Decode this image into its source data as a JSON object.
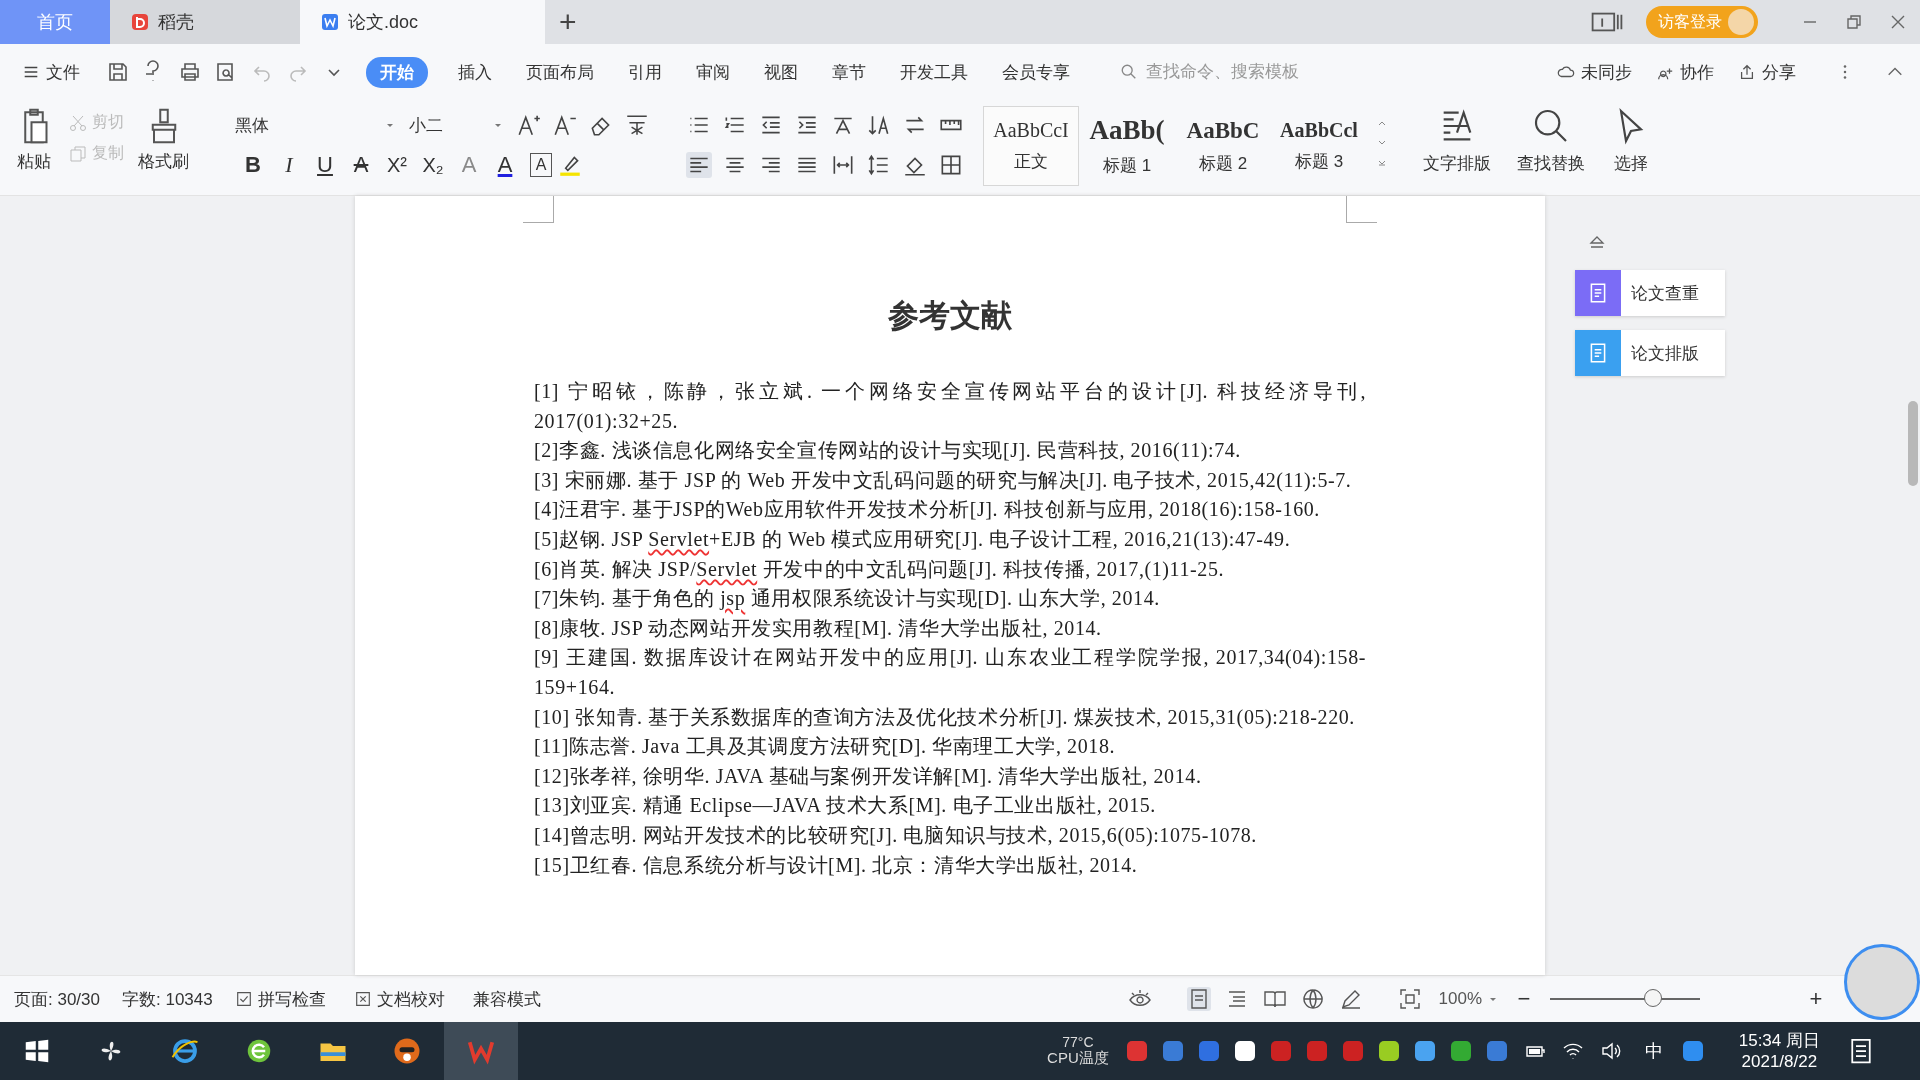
{
  "tabs": [
    {
      "label": "首页",
      "selected": false,
      "kind": "home"
    },
    {
      "label": "稻壳",
      "selected": false,
      "kind": "docer"
    },
    {
      "label": "论文.doc",
      "selected": true,
      "kind": "doc"
    }
  ],
  "new_tab": "+",
  "account": {
    "label": "访客登录"
  },
  "menu": {
    "file": "文件",
    "items": [
      {
        "label": "开始",
        "selected": true
      },
      {
        "label": "插入",
        "selected": false
      },
      {
        "label": "页面布局",
        "selected": false
      },
      {
        "label": "引用",
        "selected": false
      },
      {
        "label": "审阅",
        "selected": false
      },
      {
        "label": "视图",
        "selected": false
      },
      {
        "label": "章节",
        "selected": false
      },
      {
        "label": "开发工具",
        "selected": false
      },
      {
        "label": "会员专享",
        "selected": false
      }
    ],
    "search_placeholder": "查找命令、搜索模板",
    "actions": [
      "未同步",
      "协作",
      "分享"
    ]
  },
  "ribbon": {
    "paste": "粘贴",
    "cut": {
      "label": "剪切",
      "disabled": true
    },
    "copy": {
      "label": "复制",
      "disabled": true
    },
    "format_painter": "格式刷",
    "font": "黑体",
    "size": "小二",
    "font_buttons": [
      {
        "glyph": "B",
        "kind": "bold"
      },
      {
        "glyph": "I",
        "kind": "italic"
      },
      {
        "glyph": "U",
        "kind": "underline"
      },
      {
        "glyph": "A",
        "kind": "strike"
      },
      {
        "glyph": "X²",
        "kind": "super"
      },
      {
        "glyph": "X₂",
        "kind": "sub"
      },
      {
        "glyph": "A",
        "kind": "effect"
      },
      {
        "glyph": "A",
        "kind": "color"
      },
      {
        "glyph": "A",
        "kind": "border"
      }
    ],
    "styles": [
      {
        "preview": "AaBbCcI",
        "label": "正文",
        "selected": true,
        "kind": "body"
      },
      {
        "preview": "AaBb(",
        "label": "标题 1",
        "selected": false,
        "kind": "h1"
      },
      {
        "preview": "AaBbC",
        "label": "标题 2",
        "selected": false,
        "kind": "h2"
      },
      {
        "preview": "AaBbCcl",
        "label": "标题 3",
        "selected": false,
        "kind": "h3"
      }
    ],
    "tools": [
      "文字排版",
      "查找替换",
      "选择"
    ]
  },
  "document": {
    "title": "参考文献",
    "references": [
      [
        {
          "text": "[1] 宁昭铱，陈静，张立斌. 一个网络安全宣传网站平台的设计[J]. 科技经济导刊, 2017(01):32+25.",
          "misspelled": false
        }
      ],
      [
        {
          "text": "[2]李鑫. 浅谈信息化网络安全宣传网站的设计与实现[J]. 民营科技, 2016(11):74.",
          "misspelled": false
        }
      ],
      [
        {
          "text": "[3] 宋丽娜. 基于 JSP 的 Web 开发中文乱码问题的研究与解决[J]. 电子技术, 2015,42(11):5-7.",
          "misspelled": false
        }
      ],
      [
        {
          "text": "[4]汪君宇. 基于JSP的Web应用软件开发技术分析[J]. 科技创新与应用, 2018(16):158-160.",
          "misspelled": false
        }
      ],
      [
        {
          "text": "[5]赵钢. JSP ",
          "misspelled": false
        },
        {
          "text": "Servlet",
          "misspelled": true
        },
        {
          "text": "+EJB 的 Web 模式应用研究[J]. 电子设计工程, 2016,21(13):47-49.",
          "misspelled": false
        }
      ],
      [
        {
          "text": "[6]肖英. 解决 JSP/",
          "misspelled": false
        },
        {
          "text": "Servlet",
          "misspelled": true
        },
        {
          "text": " 开发中的中文乱码问题[J]. 科技传播, 2017,(1)11-25.",
          "misspelled": false
        }
      ],
      [
        {
          "text": "[7]朱钧. 基于角色的 ",
          "misspelled": false
        },
        {
          "text": "jsp",
          "misspelled": true
        },
        {
          "text": " 通用权限系统设计与实现[D]. 山东大学, 2014.",
          "misspelled": false
        }
      ],
      [
        {
          "text": "[8]康牧. JSP 动态网站开发实用教程[M]. 清华大学出版社, 2014.",
          "misspelled": false
        }
      ],
      [
        {
          "text": "[9] 王建国. 数据库设计在网站开发中的应用[J]. 山东农业工程学院学报, 2017,34(04):158-159+164.",
          "misspelled": false
        }
      ],
      [
        {
          "text": "[10] 张知青. 基于关系数据库的查询方法及优化技术分析[J]. 煤炭技术, 2015,31(05):218-220.",
          "misspelled": false
        }
      ],
      [
        {
          "text": "[11]陈志誉. Java 工具及其调度方法研究[D]. 华南理工大学, 2018.",
          "misspelled": false
        }
      ],
      [
        {
          "text": "[12]张孝祥, 徐明华. JAVA 基础与案例开发详解[M]. 清华大学出版社, 2014.",
          "misspelled": false
        }
      ],
      [
        {
          "text": "[13]刘亚宾. 精通 Eclipse—JAVA 技术大系[M]. 电子工业出版社, 2015.",
          "misspelled": false
        }
      ],
      [
        {
          "text": "[14]曾志明. 网站开发技术的比较研究[J]. 电脑知识与技术, 2015,6(05):1075-1078.",
          "misspelled": false
        }
      ],
      [
        {
          "text": "[15]卫红春. 信息系统分析与设计[M]. 北京：清华大学出版社, 2014.",
          "misspelled": false
        }
      ]
    ]
  },
  "side_panel": [
    {
      "label": "论文查重",
      "color": "#7b6cf6"
    },
    {
      "label": "论文排版",
      "color": "#3aa0f0"
    }
  ],
  "status_bar": {
    "page": "页面: 30/30",
    "words": "字数: 10343",
    "spell": "拼写检查",
    "proof": "文档校对",
    "mode": "兼容模式",
    "zoom": "100%",
    "zoom_slider": {
      "level": 0.69
    },
    "minus": "−",
    "plus": "+"
  },
  "taskbar": {
    "temp": "77°C",
    "temp_label": "CPU温度",
    "ime": "中",
    "time": "15:34 周日",
    "date": "2021/8/22"
  }
}
